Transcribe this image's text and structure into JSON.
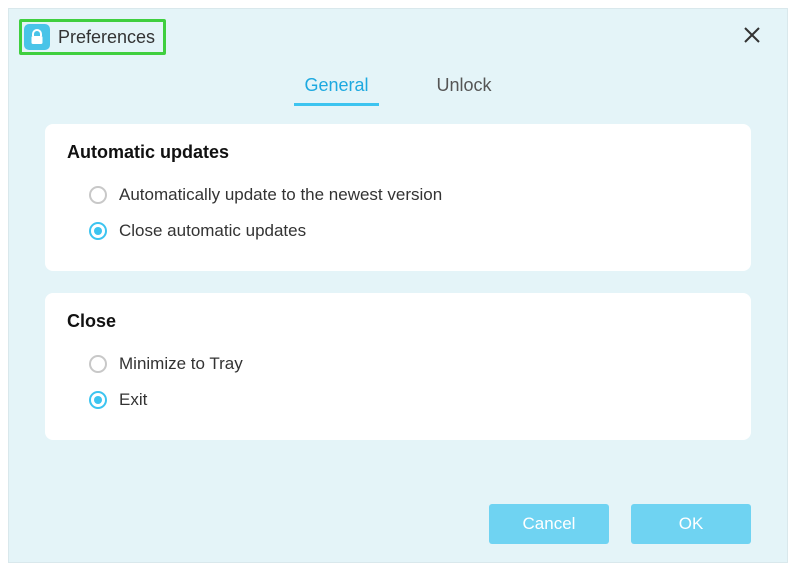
{
  "window": {
    "title": "Preferences"
  },
  "tabs": {
    "general": "General",
    "unlock": "Unlock",
    "active": "general"
  },
  "sections": {
    "updates": {
      "title": "Automatic updates",
      "opt_auto": "Automatically update to the newest version",
      "opt_close": "Close automatic updates",
      "selected": "opt_close"
    },
    "close": {
      "title": "Close",
      "opt_tray": "Minimize to Tray",
      "opt_exit": "Exit",
      "selected": "opt_exit"
    }
  },
  "buttons": {
    "cancel": "Cancel",
    "ok": "OK"
  },
  "colors": {
    "accent": "#3cc4f0",
    "panel_bg": "#e4f4f8",
    "highlight_border": "#3fcf3f"
  }
}
